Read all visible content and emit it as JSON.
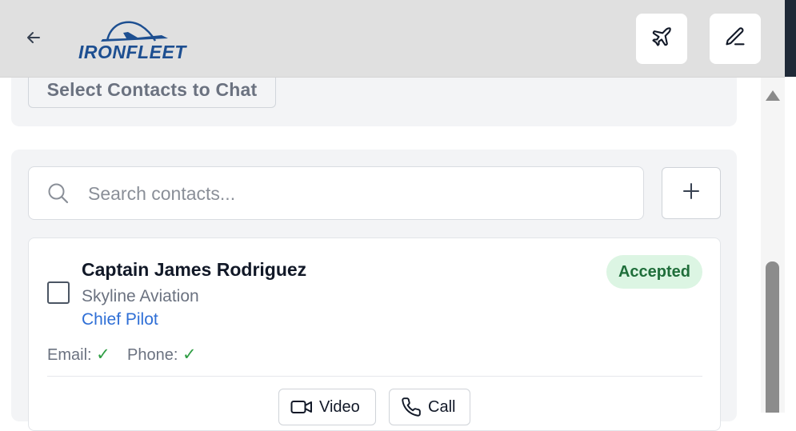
{
  "header": {
    "logo_text": "IRONFLEET",
    "back_icon": "arrow-left-icon",
    "plane_icon": "airplane-icon",
    "edit_icon": "pencil-icon"
  },
  "select_contacts_label": "Select Contacts to Chat",
  "search": {
    "placeholder": "Search contacts...",
    "value": ""
  },
  "add_label": "+",
  "contact": {
    "name": "Captain James Rodriguez",
    "company": "Skyline Aviation",
    "role": "Chief Pilot",
    "status": "Accepted",
    "email_label": "Email:",
    "email_check": "✓",
    "phone_label": "Phone:",
    "phone_check": "✓",
    "video_label": "Video",
    "call_label": "Call"
  },
  "colors": {
    "brand_blue": "#1d4f91",
    "role_blue": "#2f6fd6",
    "accepted_bg": "#dcf5e3",
    "accepted_text": "#1f6e3a",
    "check_green": "#2f9e44"
  }
}
